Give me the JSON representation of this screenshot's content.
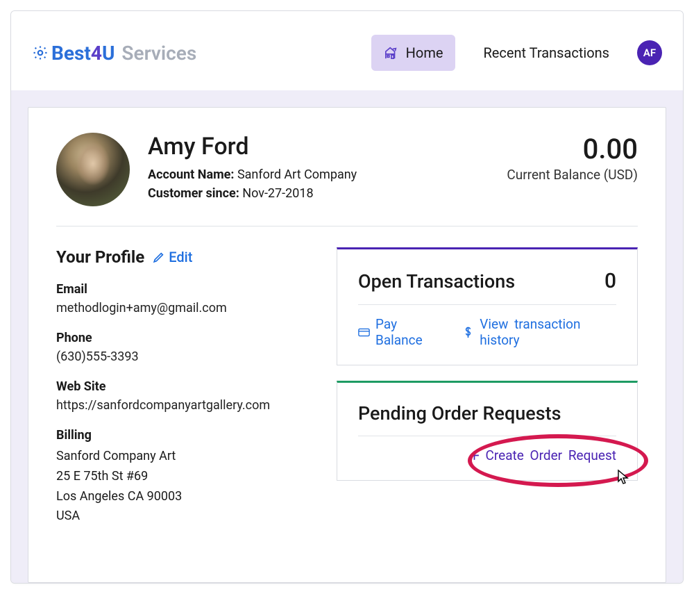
{
  "brand": {
    "best": "Best",
    "four": "4",
    "u": "U",
    "services": "Services"
  },
  "nav": {
    "home": "Home",
    "recent": "Recent Transactions",
    "avatar_initials": "AF"
  },
  "profile": {
    "name": "Amy Ford",
    "account_label": "Account Name:",
    "account_value": "Sanford Art Company",
    "since_label": "Customer since:",
    "since_value": "Nov-27-2018"
  },
  "balance": {
    "amount": "0.00",
    "label": "Current Balance (USD)"
  },
  "your_profile": {
    "title": "Your Profile",
    "edit": "Edit"
  },
  "contact": {
    "email_label": "Email",
    "email_value": "methodlogin+amy@gmail.com",
    "phone_label": "Phone",
    "phone_value": "(630)555-3393",
    "website_label": "Web Site",
    "website_value": "https://sanfordcompanyartgallery.com",
    "billing_label": "Billing",
    "billing_company": "Sanford Company Art",
    "billing_street": "25 E 75th St #69",
    "billing_city": "Los Angeles CA 90003",
    "billing_country": "USA"
  },
  "panels": {
    "open_transactions": {
      "title": "Open Transactions",
      "count": "0",
      "pay_balance": "Pay  Balance",
      "view_history": "View  transaction  history"
    },
    "pending_orders": {
      "title": "Pending Order Requests",
      "create": "Create  Order  Request"
    }
  }
}
